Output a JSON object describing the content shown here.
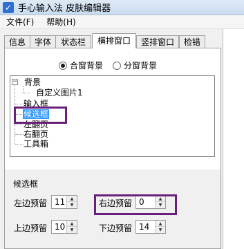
{
  "window": {
    "title": "手心输入法 皮肤编辑器"
  },
  "menu": {
    "file": "文件(F)",
    "help": "帮助(H)"
  },
  "tabs": [
    "信息",
    "字体",
    "状态栏",
    "横排窗口",
    "竖排窗口",
    "检错"
  ],
  "active_tab": "横排窗口",
  "background_mode": {
    "combined": "合窗背景",
    "split": "分窗背景",
    "selected": "合窗背景"
  },
  "tree": {
    "root": "背景",
    "child": "自定义图片1",
    "items": [
      "输入框",
      "候选框",
      "左翻页",
      "右翻页",
      "工具箱"
    ],
    "selected": "候选框"
  },
  "group": {
    "title": "候选框",
    "left_margin_label": "左边预留",
    "left_margin_value": "11",
    "right_margin_label": "右边预留",
    "right_margin_value": "0",
    "top_margin_label": "上边预留",
    "top_margin_value": "10",
    "bottom_margin_label": "下边预留",
    "bottom_margin_value": "14"
  },
  "icons": {
    "app": "checkmark-app-icon",
    "spin_up": "spin-up-arrow-icon",
    "spin_down": "spin-down-arrow-icon"
  },
  "colors": {
    "selection": "#3399ff",
    "highlight": "#6b1f7c"
  }
}
